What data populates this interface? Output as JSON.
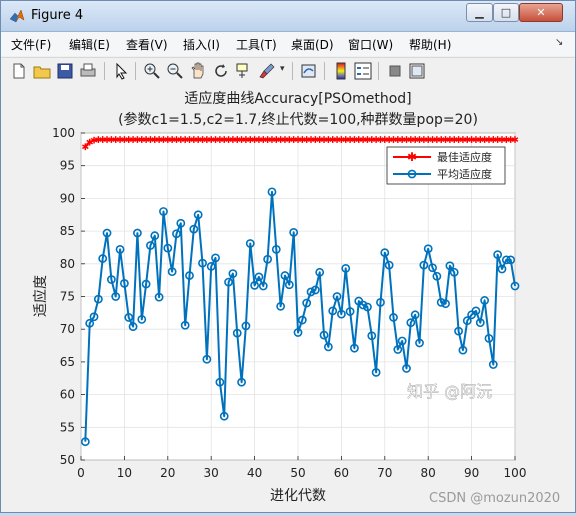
{
  "window": {
    "title": "Figure 4",
    "controls": {
      "minimize": "▁",
      "maximize": "□",
      "close": "✕"
    }
  },
  "menu": [
    {
      "label": "文件(F)"
    },
    {
      "label": "编辑(E)"
    },
    {
      "label": "查看(V)"
    },
    {
      "label": "插入(I)"
    },
    {
      "label": "工具(T)"
    },
    {
      "label": "桌面(D)"
    },
    {
      "label": "窗口(W)"
    },
    {
      "label": "帮助(H)"
    }
  ],
  "toolbar": [
    "new-figure-icon",
    "open-icon",
    "save-icon",
    "print-icon",
    "pointer-icon",
    "zoom-in-icon",
    "zoom-out-icon",
    "pan-icon",
    "rotate-icon",
    "data-cursor-icon",
    "brush-icon",
    "link-icon",
    "colorbar-icon",
    "legend-icon",
    "hide-plot-tools-icon",
    "show-plot-tools-icon"
  ],
  "watermarks": {
    "zhihu": "知乎 @阿沅",
    "csdn": "CSDN @mozun2020"
  },
  "chart_data": {
    "type": "line",
    "title": "适应度曲线Accuracy[PSOmethod]",
    "subtitle": "(参数c1=1.5,c2=1.7,终止代数=100,种群数量pop=20)",
    "xlabel": "进化代数",
    "ylabel": "适应度",
    "xlim": [
      0,
      100
    ],
    "ylim": [
      50,
      100
    ],
    "xticks": [
      0,
      10,
      20,
      30,
      40,
      50,
      60,
      70,
      80,
      90,
      100
    ],
    "yticks": [
      50,
      55,
      60,
      65,
      70,
      75,
      80,
      85,
      90,
      95,
      100
    ],
    "grid": true,
    "legend_position": "top-right",
    "series": [
      {
        "name": "最佳适应度",
        "color": "#ff0000",
        "marker": "asterisk",
        "x": [
          1,
          2,
          3,
          4,
          5,
          6,
          7,
          8,
          9,
          10,
          11,
          12,
          13,
          14,
          15,
          16,
          17,
          18,
          19,
          20,
          21,
          22,
          23,
          24,
          25,
          26,
          27,
          28,
          29,
          30,
          31,
          32,
          33,
          34,
          35,
          36,
          37,
          38,
          39,
          40,
          41,
          42,
          43,
          44,
          45,
          46,
          47,
          48,
          49,
          50,
          51,
          52,
          53,
          54,
          55,
          56,
          57,
          58,
          59,
          60,
          61,
          62,
          63,
          64,
          65,
          66,
          67,
          68,
          69,
          70,
          71,
          72,
          73,
          74,
          75,
          76,
          77,
          78,
          79,
          80,
          81,
          82,
          83,
          84,
          85,
          86,
          87,
          88,
          89,
          90,
          91,
          92,
          93,
          94,
          95,
          96,
          97,
          98,
          99,
          100
        ],
        "values": [
          97.9,
          98.6,
          98.9,
          99,
          99,
          99,
          99,
          99,
          99,
          99,
          99,
          99,
          99,
          99,
          99,
          99,
          99,
          99,
          99,
          99,
          99,
          99,
          99,
          99,
          99,
          99,
          99,
          99,
          99,
          99,
          99,
          99,
          99,
          99,
          99,
          99,
          99,
          99,
          99,
          99,
          99,
          99,
          99,
          99,
          99,
          99,
          99,
          99,
          99,
          99,
          99,
          99,
          99,
          99,
          99,
          99,
          99,
          99,
          99,
          99,
          99,
          99,
          99,
          99,
          99,
          99,
          99,
          99,
          99,
          99,
          99,
          99,
          99,
          99,
          99,
          99,
          99,
          99,
          99,
          99,
          99,
          99,
          99,
          99,
          99,
          99,
          99,
          99,
          99,
          99,
          99,
          99,
          99,
          99,
          99,
          99,
          99,
          99,
          99,
          99
        ]
      },
      {
        "name": "平均适应度",
        "color": "#0072bd",
        "marker": "circle",
        "x": [
          1,
          2,
          3,
          4,
          5,
          6,
          7,
          8,
          9,
          10,
          11,
          12,
          13,
          14,
          15,
          16,
          17,
          18,
          19,
          20,
          21,
          22,
          23,
          24,
          25,
          26,
          27,
          28,
          29,
          30,
          31,
          32,
          33,
          34,
          35,
          36,
          37,
          38,
          39,
          40,
          41,
          42,
          43,
          44,
          45,
          46,
          47,
          48,
          49,
          50,
          51,
          52,
          53,
          54,
          55,
          56,
          57,
          58,
          59,
          60,
          61,
          62,
          63,
          64,
          65,
          66,
          67,
          68,
          69,
          70,
          71,
          72,
          73,
          74,
          75,
          76,
          77,
          78,
          79,
          80,
          81,
          82,
          83,
          84,
          85,
          86,
          87,
          88,
          89,
          90,
          91,
          92,
          93,
          94,
          95,
          96,
          97,
          98,
          99,
          100
        ],
        "values": [
          52.8,
          70.9,
          71.9,
          74.6,
          80.8,
          84.7,
          77.6,
          75,
          82.2,
          77,
          71.8,
          70.4,
          84.7,
          71.5,
          76.9,
          82.8,
          84.3,
          74.9,
          88,
          82.4,
          78.8,
          84.6,
          86.2,
          70.6,
          78.2,
          85.3,
          87.5,
          80.1,
          65.4,
          79.6,
          80.9,
          61.9,
          56.7,
          77.2,
          78.5,
          69.4,
          61.9,
          70.5,
          83.1,
          76.7,
          78,
          76.6,
          80.7,
          91,
          82.2,
          73.5,
          78.2,
          76.8,
          84.8,
          69.5,
          71.4,
          74,
          75.7,
          76,
          78.7,
          69.1,
          67.3,
          72.8,
          75,
          72.3,
          79.3,
          72.7,
          67.1,
          74.3,
          73.7,
          73.4,
          69,
          63.4,
          74.1,
          81.7,
          79.8,
          71.8,
          66.9,
          68.2,
          64,
          71,
          72.2,
          67.9,
          79.8,
          82.3,
          79.4,
          78.1,
          74.1,
          73.9,
          79.7,
          78.7,
          69.7,
          66.8,
          71.3,
          72.2,
          72.8,
          71,
          74.4,
          68.6,
          64.6,
          81.4,
          79.2,
          80.6,
          80.6,
          76.6
        ]
      }
    ]
  }
}
